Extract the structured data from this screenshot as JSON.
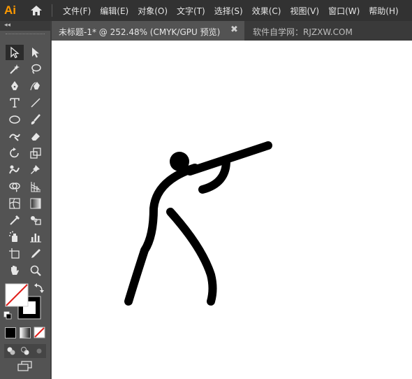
{
  "app": {
    "logo": "Ai"
  },
  "menu": [
    "文件(F)",
    "编辑(E)",
    "对象(O)",
    "文字(T)",
    "选择(S)",
    "效果(C)",
    "视图(V)",
    "窗口(W)",
    "帮助(H)"
  ],
  "document_tab": {
    "title": "未标题-1* @ 252.48% (CMYK/GPU 预览)",
    "close": "✖"
  },
  "watermark": "软件自学网：RJZXW.COM",
  "toolbar": {
    "collapse": "◂◂",
    "tools": [
      "selection-tool",
      "direct-selection-tool",
      "magic-wand-tool",
      "lasso-tool",
      "pen-tool",
      "curvature-tool",
      "type-tool",
      "line-segment-tool",
      "ellipse-tool",
      "paintbrush-tool",
      "shaper-tool",
      "eraser-tool",
      "rotate-tool",
      "scale-tool",
      "warp-tool",
      "puppet-warp-tool",
      "shape-builder-tool",
      "perspective-grid-tool",
      "mesh-tool",
      "gradient-tool",
      "eyedropper-tool",
      "blend-tool",
      "symbol-sprayer-tool",
      "column-graph-tool",
      "artboard-tool",
      "slice-tool",
      "hand-tool",
      "zoom-tool"
    ]
  },
  "colors": {
    "fill": "#ffffff",
    "stroke": "#000000",
    "accent": "#ff9a00"
  }
}
